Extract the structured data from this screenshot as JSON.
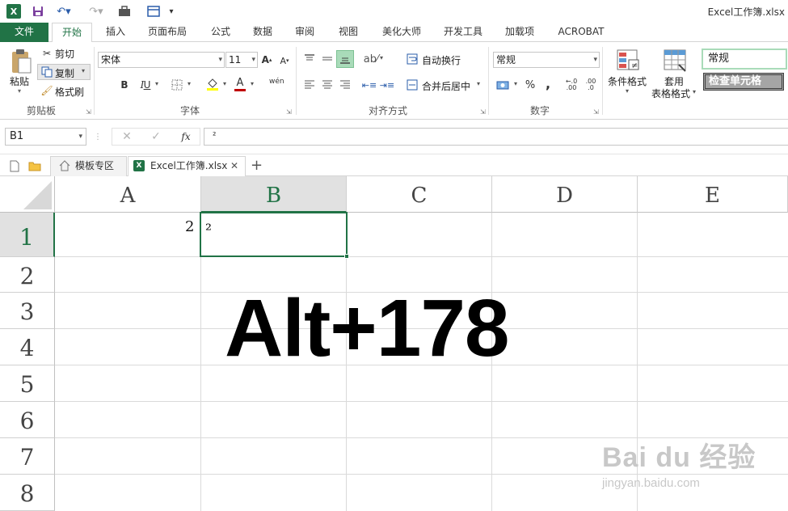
{
  "titlebar": {
    "doc_title": "Excel工作簿.xlsx"
  },
  "ribbon_tabs": [
    "文件",
    "开始",
    "插入",
    "页面布局",
    "公式",
    "数据",
    "审阅",
    "视图",
    "美化大师",
    "开发工具",
    "加载项",
    "ACROBAT"
  ],
  "clipboard": {
    "paste_label": "粘贴",
    "cut_label": "剪切",
    "copy_label": "复制",
    "format_painter_label": "格式刷",
    "group_label": "剪贴板"
  },
  "font": {
    "font_name": "宋体",
    "font_size": "11",
    "bold": "B",
    "italic": "I",
    "underline": "U",
    "phonetic_label": "wén",
    "group_label": "字体"
  },
  "alignment": {
    "wrap_text_label": "自动换行",
    "merge_center_label": "合并后居中",
    "group_label": "对齐方式"
  },
  "number": {
    "format_value": "常规",
    "percent": "%",
    "comma": ",",
    "inc_decimal": ".00",
    "dec_decimal": ".0",
    "group_label": "数字"
  },
  "styles": {
    "conditional_label": "条件格式",
    "table_format_label_1": "套用",
    "table_format_label_2": "表格格式",
    "style_normal": "常规",
    "style_check_cell": "检查单元格"
  },
  "formula_bar": {
    "name_box": "B1",
    "fx": "fx",
    "formula": "²"
  },
  "doc_tabs": {
    "template_tab": "模板专区",
    "workbook_tab": "Excel工作簿.xlsx",
    "close": "✕",
    "add": "+"
  },
  "sheet": {
    "columns": [
      "A",
      "B",
      "C",
      "D",
      "E"
    ],
    "rows": [
      "1",
      "2",
      "3",
      "4",
      "5",
      "6",
      "7",
      "8"
    ],
    "selected_cell": "B1",
    "cells": {
      "A1": "2",
      "B1": "²"
    }
  },
  "overlay": {
    "text": "Alt+178"
  },
  "watermark": {
    "brand": "Bai du 经验",
    "url": "jingyan.baidu.com"
  },
  "colors": {
    "excel_green": "#217346",
    "font_color_red": "#c00000",
    "fill_yellow": "#ffff00"
  }
}
